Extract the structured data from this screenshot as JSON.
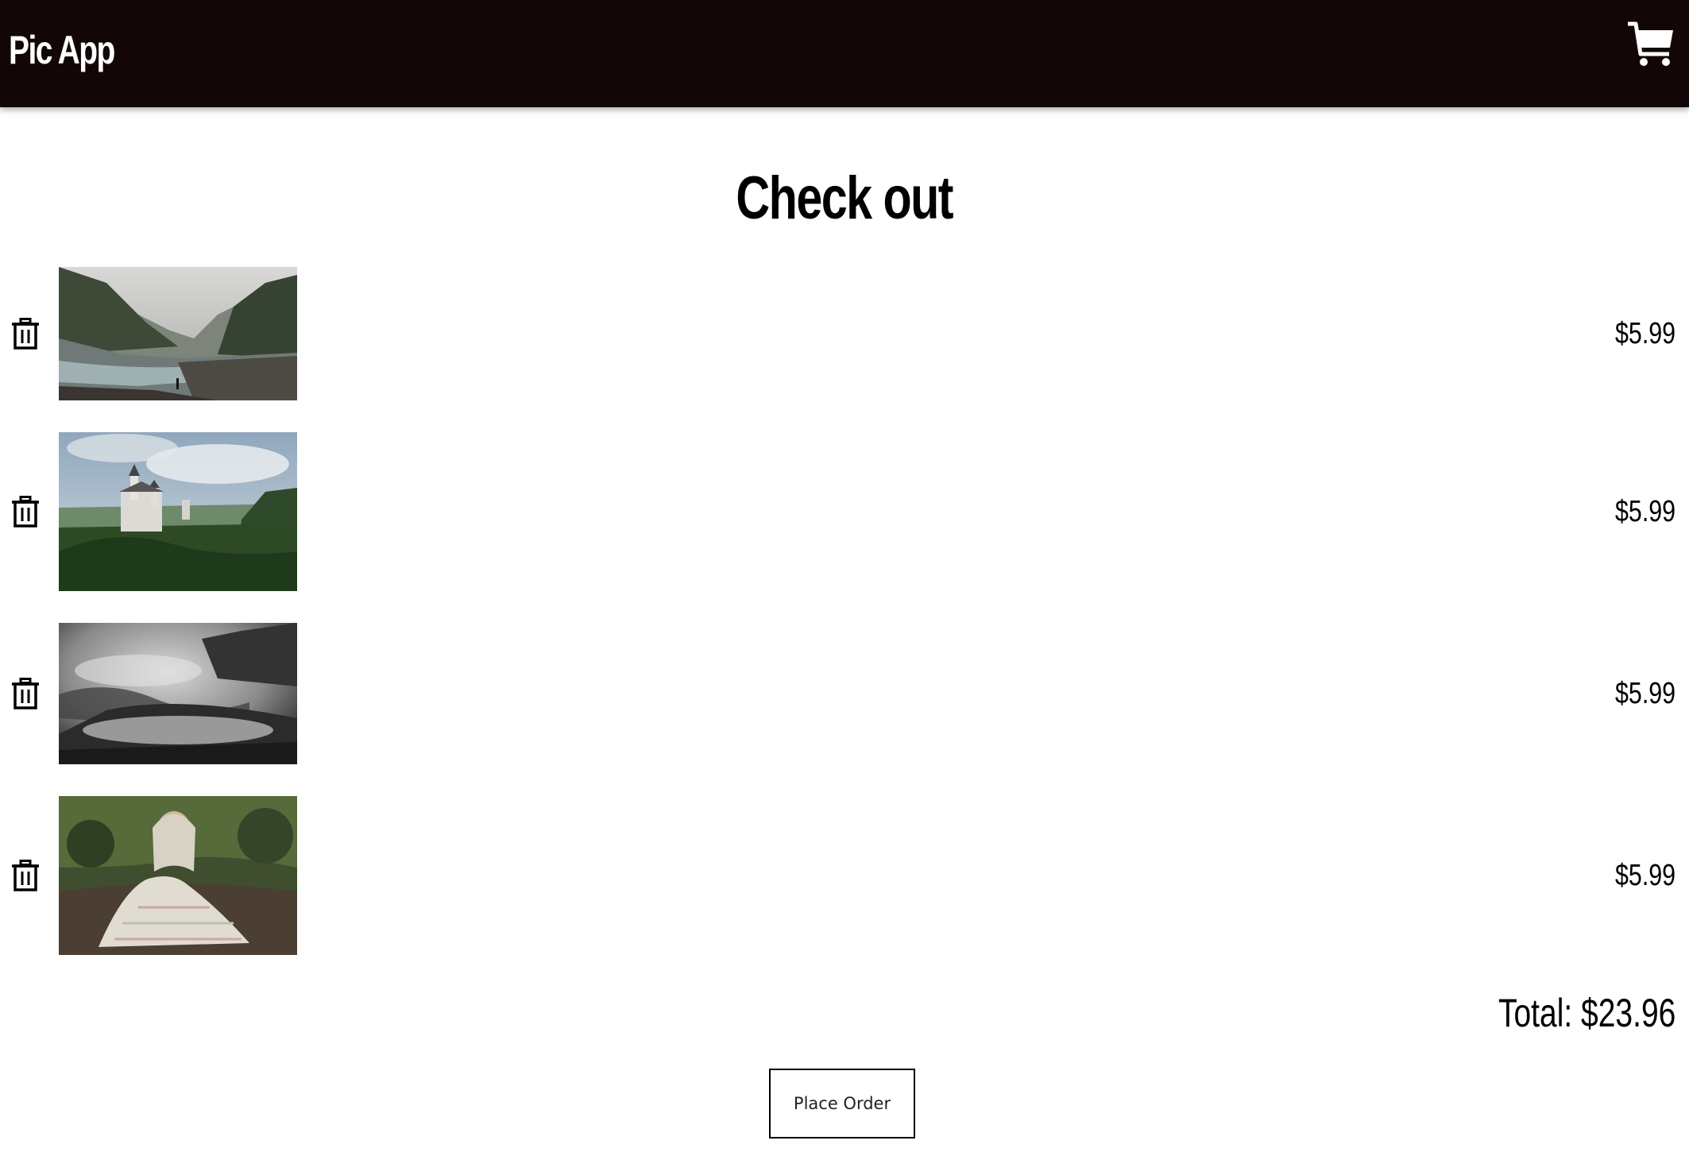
{
  "header": {
    "app_title": "Pic App",
    "cart_icon": "cart-icon"
  },
  "page": {
    "heading": "Check out"
  },
  "cart": {
    "items": [
      {
        "image": "river-mountain-photo",
        "price": "$5.99",
        "remove_icon": "trash-icon"
      },
      {
        "image": "castle-landscape-photo",
        "price": "$5.99",
        "remove_icon": "trash-icon"
      },
      {
        "image": "misty-forest-photo",
        "price": "$5.99",
        "remove_icon": "trash-icon"
      },
      {
        "image": "pug-blanket-photo",
        "price": "$5.99",
        "remove_icon": "trash-icon"
      }
    ],
    "total": "Total: $23.96",
    "place_order_label": "Place Order"
  },
  "colors": {
    "header_bg": "#120706",
    "header_text": "#ffffff",
    "page_bg": "#ffffff",
    "text": "#000000"
  }
}
